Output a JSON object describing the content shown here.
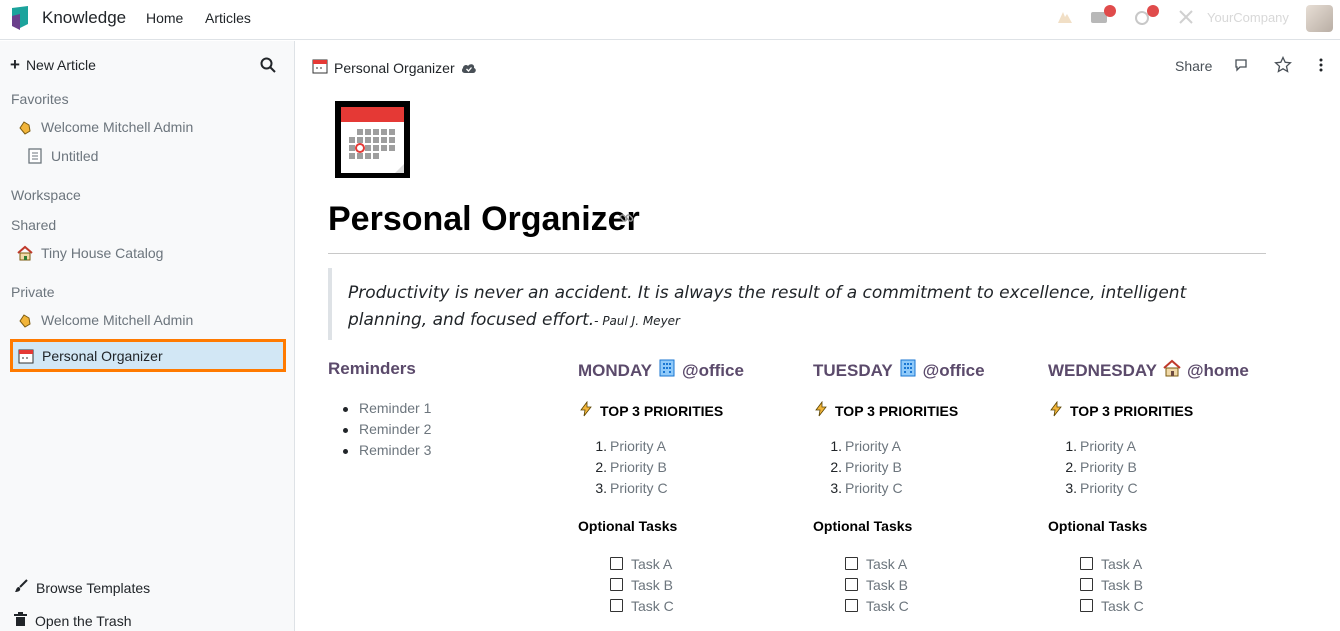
{
  "topbar": {
    "app_name": "Knowledge",
    "nav": [
      "Home",
      "Articles"
    ],
    "company": "YourCompany"
  },
  "sidebar": {
    "new_article": "New Article",
    "favorites_title": "Favorites",
    "favorites": [
      {
        "label": "Welcome Mitchell Admin",
        "icon": "waving-hand-icon"
      },
      {
        "label": "Untitled",
        "icon": "document-icon"
      }
    ],
    "workspace_title": "Workspace",
    "shared_title": "Shared",
    "shared": [
      {
        "label": "Tiny House Catalog",
        "icon": "house-icon"
      }
    ],
    "private_title": "Private",
    "private": [
      {
        "label": "Welcome Mitchell Admin",
        "icon": "waving-hand-icon"
      },
      {
        "label": "Personal Organizer",
        "icon": "calendar-icon",
        "active": true
      }
    ],
    "browse_templates": "Browse Templates",
    "open_trash": "Open the Trash"
  },
  "header": {
    "breadcrumb": "Personal Organizer",
    "share": "Share"
  },
  "article": {
    "title": "Personal Organizer",
    "quote": "Productivity is never an accident. It is always the result of a commitment to excellence, intelligent planning, and focused effort.",
    "quote_author": "- Paul J. Meyer",
    "reminders": {
      "heading": "Reminders",
      "items": [
        "Reminder 1",
        "Reminder 2",
        "Reminder 3"
      ]
    },
    "days": [
      {
        "day": "MONDAY",
        "location": "@office",
        "emoji": "office-building-icon"
      },
      {
        "day": "TUESDAY",
        "location": "@office",
        "emoji": "office-building-icon"
      },
      {
        "day": "WEDNESDAY",
        "location": "@home",
        "emoji": "house-icon"
      }
    ],
    "priorities_heading": "TOP 3 PRIORITIES",
    "priorities": [
      "Priority A",
      "Priority B",
      "Priority C"
    ],
    "optional_heading": "Optional Tasks",
    "tasks": [
      "Task A",
      "Task B",
      "Task C"
    ]
  },
  "colors": {
    "heading": "#5b4a6b",
    "active_bg": "#d2e7f5",
    "highlight_border": "#ff7a00"
  }
}
